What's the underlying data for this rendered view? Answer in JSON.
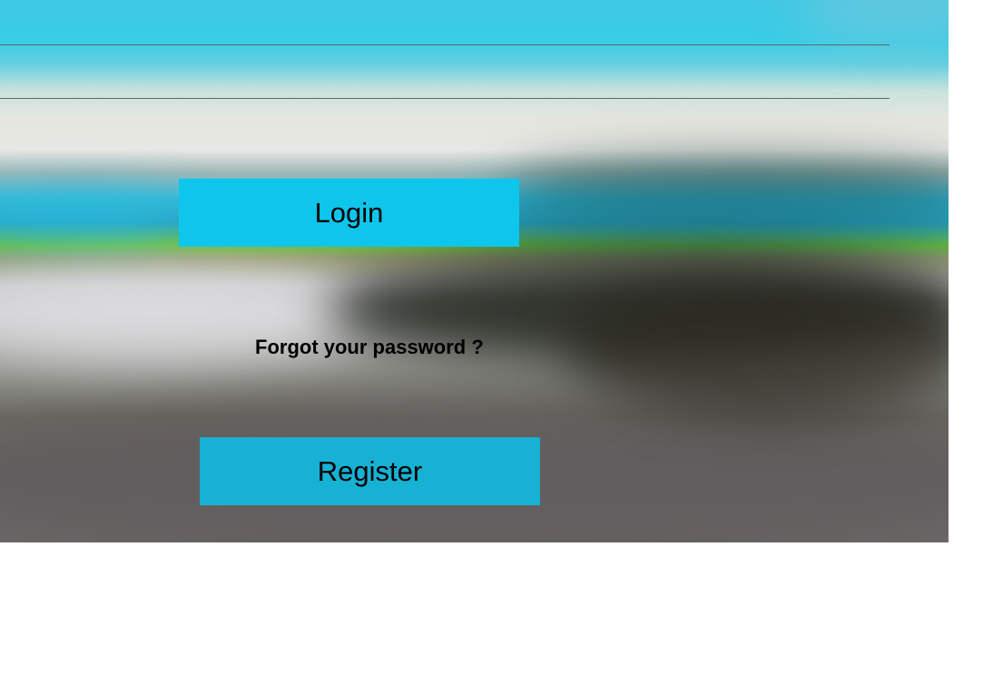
{
  "login_form": {
    "username_value": "",
    "password_value": "",
    "login_label": "Login",
    "forgot_password_label": "Forgot your password ?",
    "register_label": "Register"
  },
  "colors": {
    "login_button": "#0ec6ec",
    "register_button": "#17b1d4",
    "page_background": "#ffffff"
  }
}
